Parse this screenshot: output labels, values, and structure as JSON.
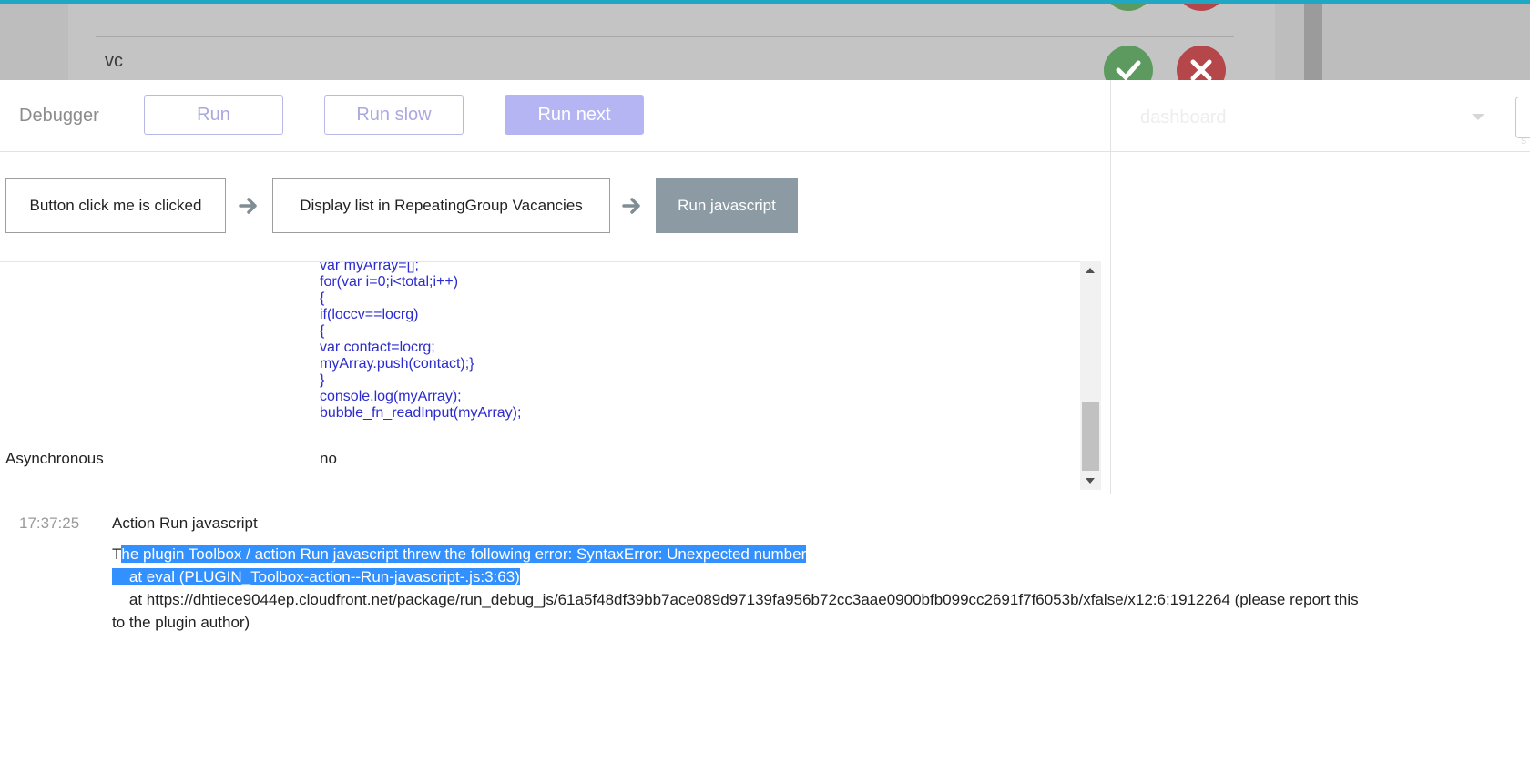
{
  "background_app": {
    "row_text": "vc"
  },
  "toolbar": {
    "title": "Debugger",
    "run_label": "Run",
    "run_slow_label": "Run slow",
    "run_next_label": "Run next",
    "page_select_value": "dashboard"
  },
  "workflow": {
    "steps": [
      "Button click me is clicked",
      "Display list in RepeatingGroup Vacancies",
      "Run javascript"
    ],
    "active_step": "Run javascript"
  },
  "properties": {
    "code_lines": [
      "var myArray=[];",
      "for(var i=0;i<total;i++)",
      "{",
      "if(loccv==locrg)",
      "{",
      "var contact=locrg;",
      "myArray.push(contact);}",
      "}",
      "console.log(myArray);",
      "bubble_fn_readInput(myArray);"
    ],
    "async_label": "Asynchronous",
    "async_value": "no"
  },
  "log": {
    "time": "17:37:25",
    "title": "Action Run javascript",
    "message_first_char": "T",
    "message_selected": "he plugin Toolbox / action Run javascript threw the following error: SyntaxError: Unexpected number",
    "stack_line_1": "    at eval (PLUGIN_Toolbox-action--Run-javascript-.js:3:63)",
    "stack_line_2": "    at https://dhtiece9044ep.cloudfront.net/package/run_debug_js/61a5f48df39bb7ace089d97139fa956b72cc3aae0900bfb099cc2691f7f6053b/xfalse/x12:6:1912264 (please report this to the plugin author)"
  },
  "colors": {
    "accent_strip": "#1fa7c3",
    "button_outline": "#b8b8e6",
    "run_next_bg": "#b4b5f2",
    "active_step_bg": "#8b9aa3",
    "code_text": "#2b2bcf",
    "selection": "#3390ff"
  }
}
